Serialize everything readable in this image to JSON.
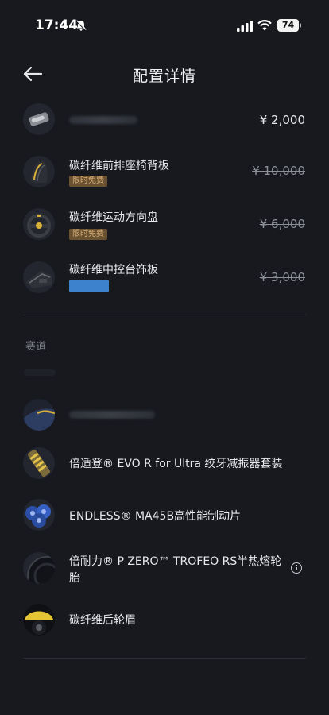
{
  "status_bar": {
    "time": "17:44",
    "battery": "74"
  },
  "header": {
    "title": "配置详情"
  },
  "top_items": [
    {
      "name": "",
      "price": "¥ 2,000",
      "strike": false,
      "badge": ""
    },
    {
      "name": "碳纤维前排座椅背板",
      "price": "¥ 10,000",
      "strike": true,
      "badge": "限时免费"
    },
    {
      "name": "碳纤维运动方向盘",
      "price": "¥ 6,000",
      "strike": true,
      "badge": "限时免费"
    },
    {
      "name": "碳纤维中控台饰板",
      "price": "¥ 3,000",
      "strike": true,
      "badge": ""
    }
  ],
  "section_title": "赛道",
  "track_items": [
    {
      "name": ""
    },
    {
      "name": "倍适登® EVO R for Ultra 绞牙减振器套装"
    },
    {
      "name": "ENDLESS® MA45B高性能制动片"
    },
    {
      "name": "倍耐力® P ZERO™ TROFEO RS半热熔轮",
      "name_line2": "胎"
    },
    {
      "name": "碳纤维后轮眉"
    }
  ],
  "colors": {
    "background": "#17191f",
    "badge_bg": "#6a5230",
    "badge_text": "#d9b27a",
    "blue_tag": "#3c82cc"
  }
}
